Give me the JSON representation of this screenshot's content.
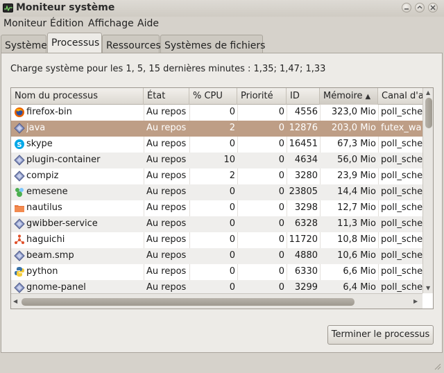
{
  "window": {
    "title": "Moniteur système"
  },
  "menu": [
    "Moniteur",
    "Édition",
    "Affichage",
    "Aide"
  ],
  "tabs": [
    "Système",
    "Processus",
    "Ressources",
    "Systèmes de fichiers"
  ],
  "active_tab": 1,
  "load_text": "Charge système pour les 1, 5, 15 dernières minutes : 1,35; 1,47; 1,33",
  "columns": [
    "Nom du processus",
    "État",
    "% CPU",
    "Priorité",
    "ID",
    "Mémoire",
    "Canal d'a"
  ],
  "sorted_column": "Mémoire",
  "selected_row": 1,
  "processes": [
    {
      "name": "firefox-bin",
      "icon": "firefox-icon",
      "state": "Au repos",
      "cpu": "0",
      "priority": "0",
      "id": "4556",
      "memory": "323,0 Mio",
      "channel": "poll_sche"
    },
    {
      "name": "java",
      "icon": "generic-process-icon",
      "state": "Au repos",
      "cpu": "2",
      "priority": "0",
      "id": "12876",
      "memory": "203,0 Mio",
      "channel": "futex_wa"
    },
    {
      "name": "skype",
      "icon": "skype-icon",
      "state": "Au repos",
      "cpu": "0",
      "priority": "0",
      "id": "16451",
      "memory": "67,3 Mio",
      "channel": "poll_sche"
    },
    {
      "name": "plugin-container",
      "icon": "generic-process-icon",
      "state": "Au repos",
      "cpu": "10",
      "priority": "0",
      "id": "4634",
      "memory": "56,0 Mio",
      "channel": "poll_sche"
    },
    {
      "name": "compiz",
      "icon": "generic-process-icon",
      "state": "Au repos",
      "cpu": "2",
      "priority": "0",
      "id": "3280",
      "memory": "23,9 Mio",
      "channel": "poll_sche"
    },
    {
      "name": "emesene",
      "icon": "emesene-icon",
      "state": "Au repos",
      "cpu": "0",
      "priority": "0",
      "id": "23805",
      "memory": "14,4 Mio",
      "channel": "poll_sche"
    },
    {
      "name": "nautilus",
      "icon": "folder-icon",
      "state": "Au repos",
      "cpu": "0",
      "priority": "0",
      "id": "3298",
      "memory": "12,7 Mio",
      "channel": "poll_sche"
    },
    {
      "name": "gwibber-service",
      "icon": "generic-process-icon",
      "state": "Au repos",
      "cpu": "0",
      "priority": "0",
      "id": "6328",
      "memory": "11,3 Mio",
      "channel": "poll_sche"
    },
    {
      "name": "haguichi",
      "icon": "haguichi-icon",
      "state": "Au repos",
      "cpu": "0",
      "priority": "0",
      "id": "11720",
      "memory": "10,8 Mio",
      "channel": "poll_sche"
    },
    {
      "name": "beam.smp",
      "icon": "generic-process-icon",
      "state": "Au repos",
      "cpu": "0",
      "priority": "0",
      "id": "4880",
      "memory": "10,6 Mio",
      "channel": "poll_sche"
    },
    {
      "name": "python",
      "icon": "python-icon",
      "state": "Au repos",
      "cpu": "0",
      "priority": "0",
      "id": "6330",
      "memory": "6,6 Mio",
      "channel": "poll_sche"
    },
    {
      "name": "gnome-panel",
      "icon": "generic-process-icon",
      "state": "Au repos",
      "cpu": "0",
      "priority": "0",
      "id": "3299",
      "memory": "6,4 Mio",
      "channel": "poll_sche"
    }
  ],
  "end_process_button": "Terminer le processus"
}
